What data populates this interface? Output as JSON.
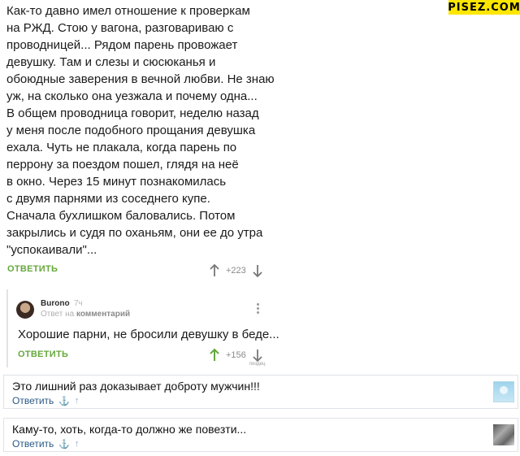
{
  "watermark": "PISEZ.COM",
  "post": {
    "lines": [
      "Как-то давно имел отношение к проверкам",
      "на РЖД. Стою у вагона, разговариваю с",
      "проводницей... Рядом парень провожает",
      "девушку. Там и слезы и сюсюканья и",
      "обоюдные заверения в вечной любви. Не знаю",
      "уж, на сколько она уезжала и почему одна...",
      "В общем проводница говорит, неделю назад",
      "у меня после подобного прощания девушка",
      "ехала. Чуть не плакала, когда парень по",
      "перрону за поездом пошел, глядя на неё",
      "в окно. Через 15 минут познакомилась",
      "с двумя парнями из соседнего купе.",
      "Сначала бухлишком баловались. Потом",
      "закрылись и судя по оханьям, они ее до утра",
      "\"успокаивали\"..."
    ],
    "reply_label": "ОТВЕТИТЬ",
    "score": "+223",
    "upvote_icon": "up-arrow-icon",
    "downvote_icon": "down-arrow-icon"
  },
  "reply": {
    "author": "Burono",
    "time": "7ч",
    "meta_prefix": "Ответ на",
    "meta_target": "комментарий",
    "text": "Хорошие парни, не бросили девушку в беде...",
    "reply_label": "ОТВЕТИТЬ",
    "score": "+156",
    "tiny_label": "пиздец",
    "upvote_color": "#65a83c"
  },
  "vk_comments": [
    {
      "text": "Это лишний раз доказывает доброту мужчин!!!",
      "reply_label": "Ответить",
      "avatar": "default-avatar"
    },
    {
      "text": "Каму-то, хоть, когда-то должно же повезти...",
      "reply_label": "Ответить",
      "avatar": "photo-avatar"
    }
  ],
  "colors": {
    "accent_green": "#65a83c",
    "link_blue": "#2a5885",
    "muted": "#8a8a8a"
  }
}
